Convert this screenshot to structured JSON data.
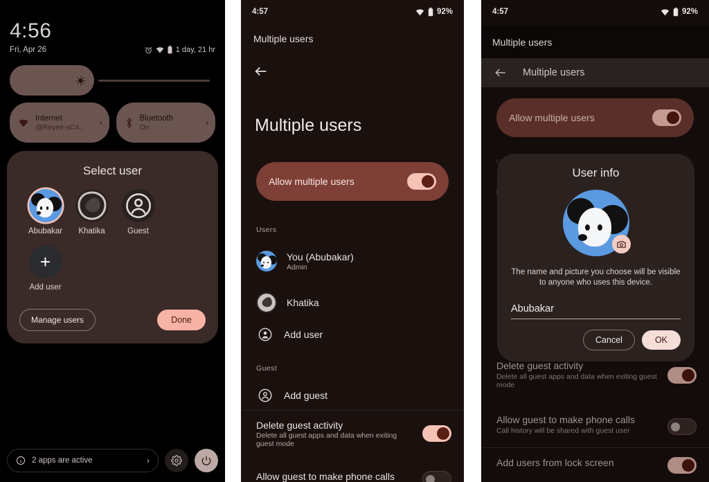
{
  "colors": {
    "accent_pink": "#f7b3a6",
    "switch_track_on": "#f6c2b6",
    "switch_thumb_on": "#5c1f15",
    "allow_card_bg": "#7d3f36",
    "card_bg": "#3b2b28",
    "avatar_blue": "#5b9ae0"
  },
  "panel1": {
    "name": "quick-settings-shade",
    "clock": "4:56",
    "date": "Fri, Apr 26",
    "status_icons": [
      "alarm-icon",
      "wifi-icon",
      "battery-icon"
    ],
    "battery_text": "1 day, 21 hr",
    "brightness": {
      "icon": "brightness-icon",
      "level_percent": 38
    },
    "tiles": [
      {
        "icon": "wifi-icon",
        "title": "Internet",
        "subtitle": "@Reyee-sC4..",
        "chevron": "chevron-right-icon"
      },
      {
        "icon": "bluetooth-icon",
        "title": "Bluetooth",
        "subtitle": "On",
        "chevron": "chevron-right-icon"
      }
    ],
    "user_card": {
      "title": "Select user",
      "users": [
        {
          "label": "Abubakar",
          "avatar": "dog-avatar",
          "selected": true
        },
        {
          "label": "Khatika",
          "avatar": "blob-avatar",
          "selected": false
        },
        {
          "label": "Guest",
          "avatar": "person-circle-icon",
          "selected": false
        },
        {
          "label": "Add user",
          "avatar": "plus-icon",
          "selected": false
        }
      ],
      "manage_label": "Manage users",
      "done_label": "Done"
    },
    "footer": {
      "active_apps_icon": "info-icon",
      "active_apps_label": "2 apps are active",
      "chevron": "chevron-right-icon",
      "settings_icon": "gear-icon",
      "power_icon": "power-icon"
    }
  },
  "panel2": {
    "name": "multiple-users-settings",
    "statusbar": {
      "time": "4:57",
      "wifi": "wifi-icon",
      "battery": "battery-icon",
      "battery_text": "92%"
    },
    "breadcrumb": "Multiple users",
    "back_icon": "arrow-back-icon",
    "page_title": "Multiple users",
    "allow_toggle": {
      "label": "Allow multiple users",
      "state": "on"
    },
    "users_section_label": "Users",
    "users": [
      {
        "title": "You (Abubakar)",
        "subtitle": "Admin",
        "icon": "dog-avatar"
      },
      {
        "title": "Khatika",
        "subtitle": "",
        "icon": "blob-avatar"
      },
      {
        "title": "Add user",
        "subtitle": "",
        "icon": "add-person-icon"
      }
    ],
    "guest_section_label": "Guest",
    "guest_items": [
      {
        "title": "Add guest",
        "subtitle": "",
        "icon": "person-circle-icon"
      }
    ],
    "settings": [
      {
        "title": "Delete guest activity",
        "subtitle": "Delete all guest apps and data when exiting guest mode",
        "state": "on"
      },
      {
        "title": "Allow guest to make phone calls",
        "subtitle": "",
        "state": "off"
      }
    ]
  },
  "panel3": {
    "name": "multiple-users-settings-with-dialog",
    "statusbar": {
      "time": "4:57",
      "wifi": "wifi-icon",
      "battery": "battery-icon",
      "battery_text": "92%"
    },
    "breadcrumb": "Multiple users",
    "appbar": {
      "back_icon": "arrow-back-icon",
      "title": "Multiple users"
    },
    "allow_toggle": {
      "label": "Allow multiple users",
      "state": "on"
    },
    "dialog": {
      "title": "User info",
      "avatar": "dog-avatar",
      "camera_badge_icon": "camera-icon",
      "description": "The name and picture you choose will be visible to anyone who uses this device.",
      "name_value": "Abubakar",
      "cancel_label": "Cancel",
      "ok_label": "OK"
    },
    "settings": [
      {
        "title": "Delete guest activity",
        "subtitle": "Delete all guest apps and data when exiting guest mode",
        "state": "on"
      },
      {
        "title": "Allow guest to make phone calls",
        "subtitle": "Call history will be shared with guest user",
        "state": "off"
      },
      {
        "title": "Add users from lock screen",
        "subtitle": "",
        "state": "on"
      }
    ]
  }
}
